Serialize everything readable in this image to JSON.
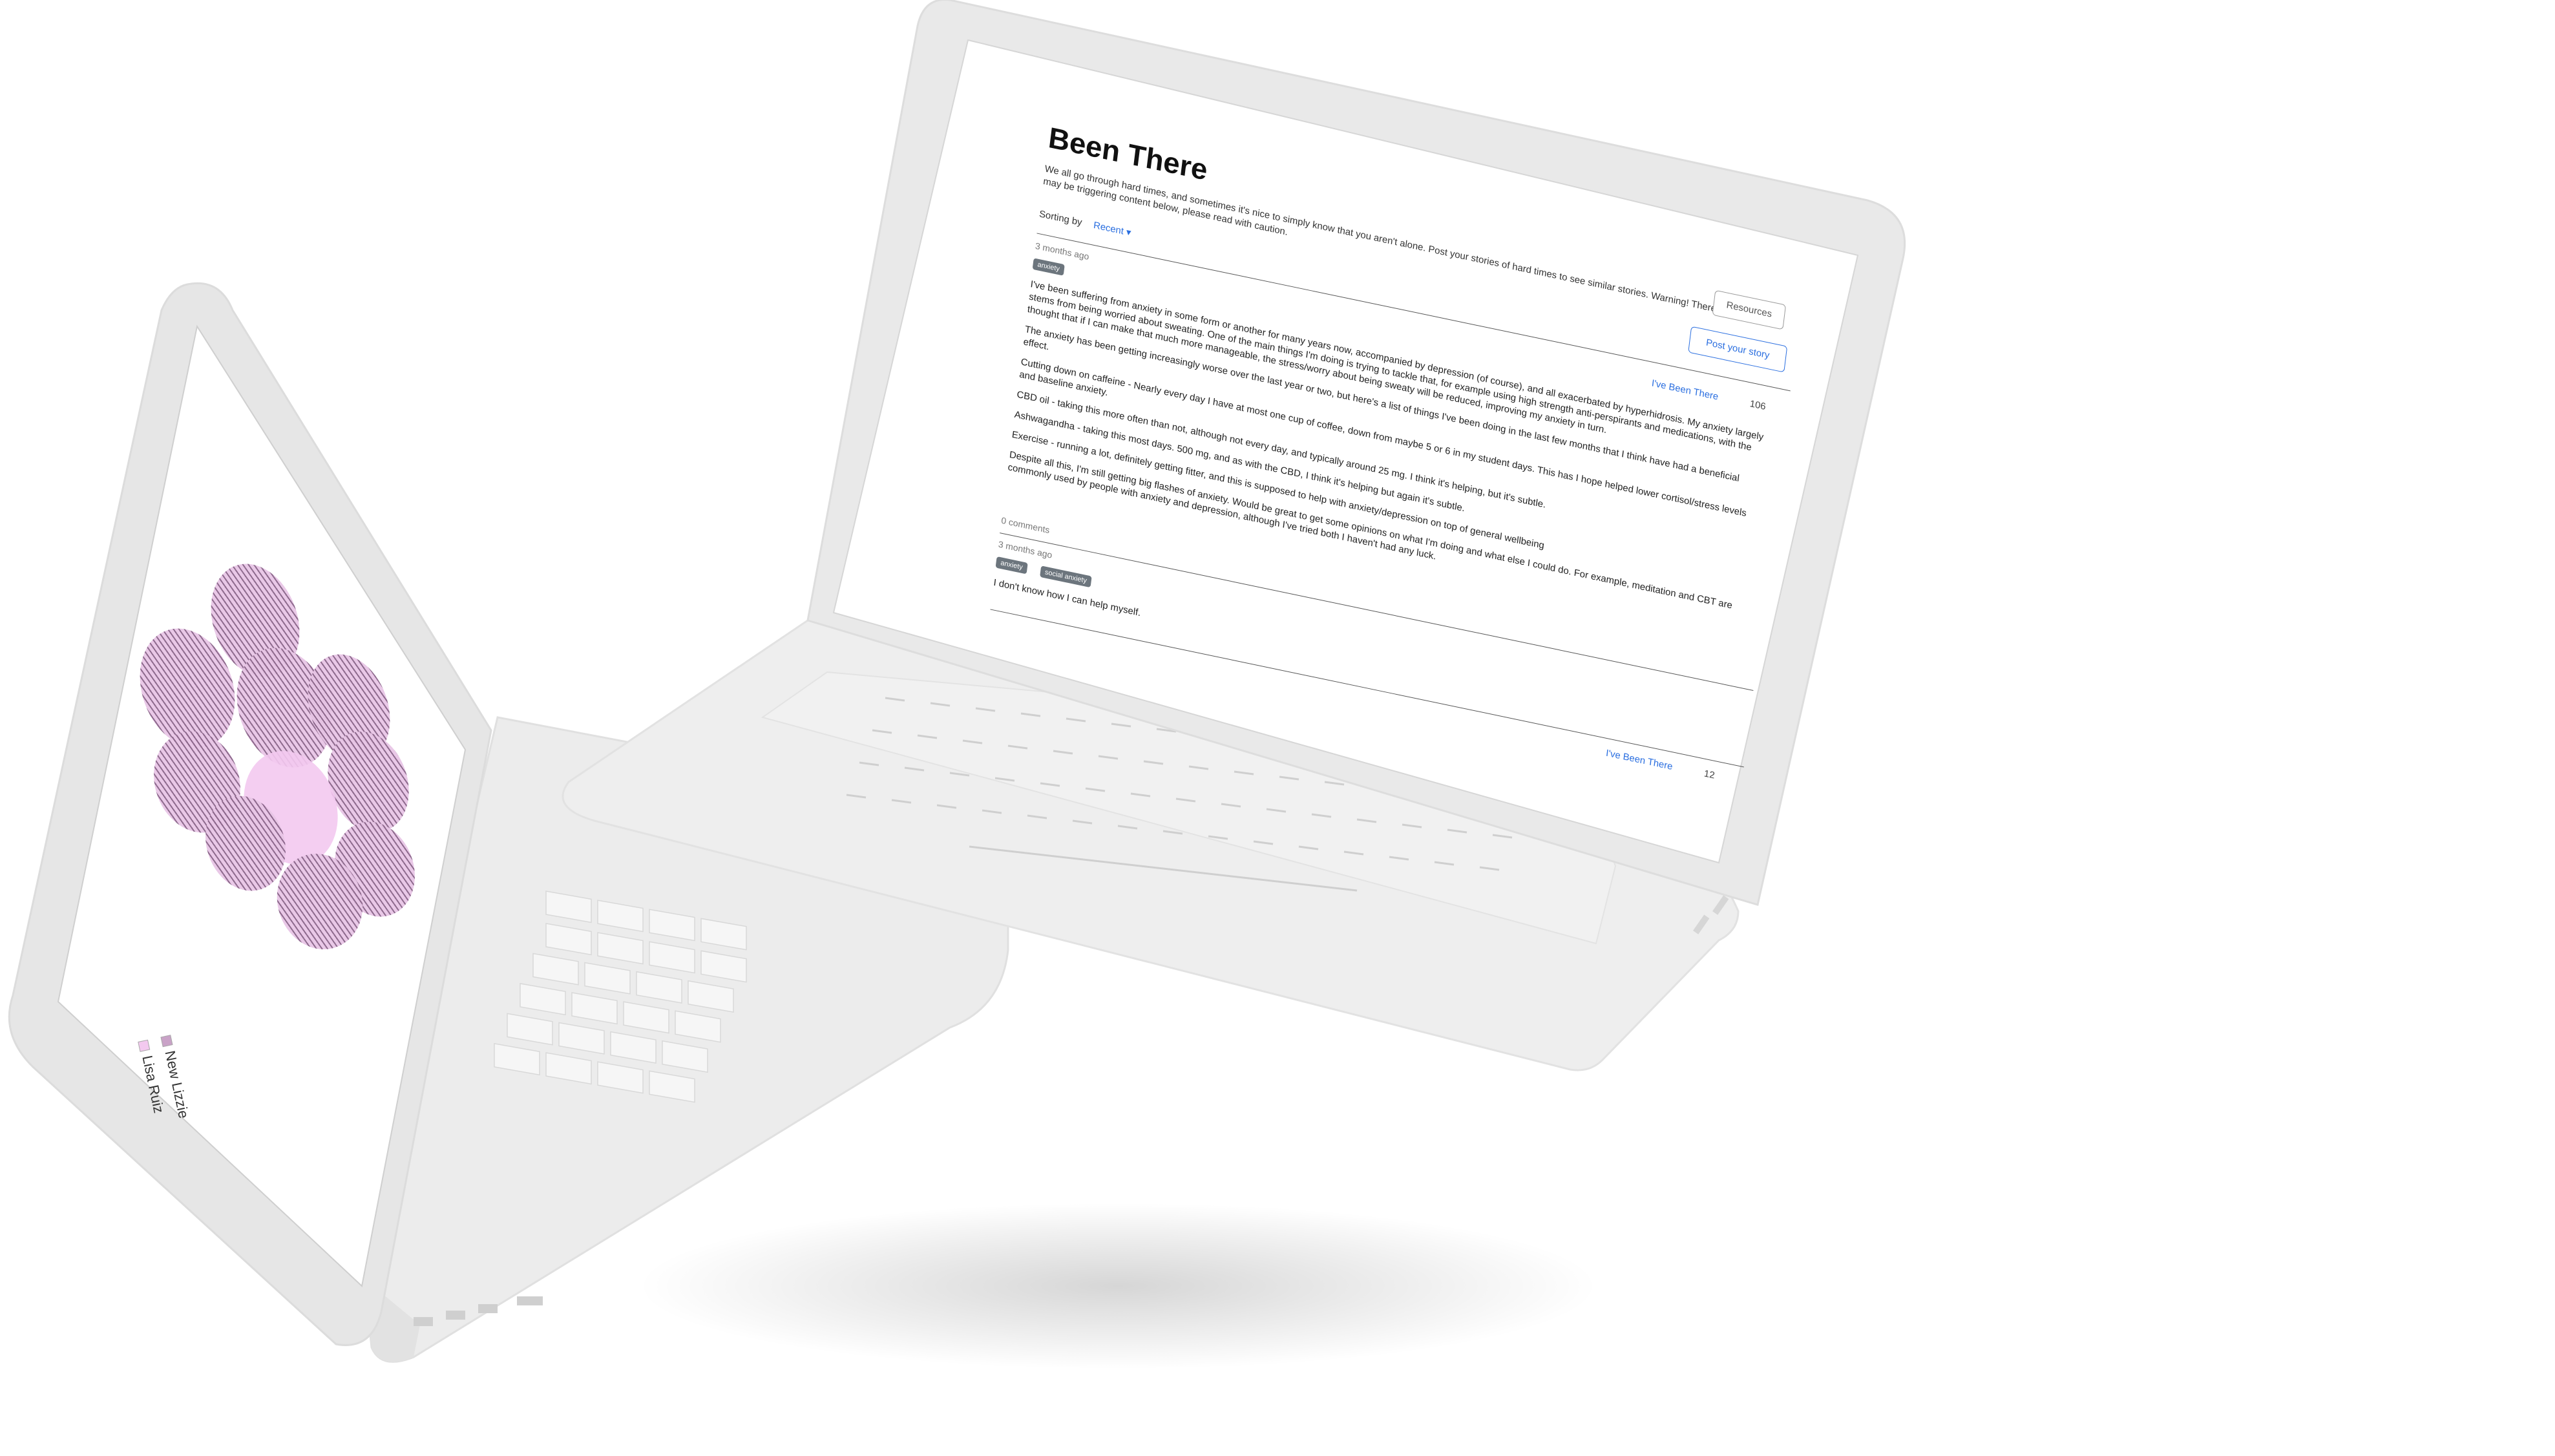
{
  "right_screen": {
    "title": "Been There",
    "intro": "We all go through hard times, and sometimes it's nice to simply know that you aren't alone. Post your stories of hard times to see similar stories. Warning! There may be triggering content below, please read with caution.",
    "sorting_label": "Sorting by",
    "sorting_value": "Recent ▾",
    "resources_button": "Resources",
    "post_story_button": "Post your story",
    "posts": [
      {
        "time": "3 months ago",
        "tags": [
          "anxiety"
        ],
        "body": [
          "I've been suffering from anxiety in some form or another for many years now, accompanied by depression (of course), and all exacerbated by hyperhidrosis. My anxiety largely stems from being worried about sweating. One of the main things I'm doing is trying to tackle that, for example using high strength anti-perspirants and medications, with the thought that if I can make that much more manageable, the stress/worry about being sweaty will be reduced, improving my anxiety in turn.",
          "The anxiety has been getting increasingly worse over the last year or two, but here's a list of things I've been doing in the last few months that I think have had a beneficial effect.",
          "Cutting down on caffeine - Nearly every day I have at most one cup of coffee, down from maybe 5 or 6 in my student days. This has I hope helped lower cortisol/stress levels and baseline anxiety.",
          "CBD oil - taking this more often than not, although not every day, and typically around 25 mg. I think it's helping, but it's subtle.",
          "Ashwagandha - taking this most days. 500 mg, and as with the CBD, I think it's helping but again it's subtle.",
          "Exercise - running a lot, definitely getting fitter, and this is supposed to help with anxiety/depression on top of general wellbeing",
          "Despite all this, I'm still getting big flashes of anxiety. Would be great to get some opinions on what I'm doing and what else I could do. For example, meditation and CBT are commonly used by people with anxiety and depression, although I've tried both I haven't had any luck."
        ],
        "been_there_label": "I've Been There",
        "been_there_count": "106",
        "comments": "0 comments"
      },
      {
        "time": "3 months ago",
        "tags": [
          "anxiety",
          "social anxiety"
        ],
        "body": [
          "I don't know how I can help myself."
        ],
        "been_there_label": "I've Been There",
        "been_there_count": "12"
      }
    ]
  },
  "left_screen": {
    "legend": [
      "New Lizzie",
      "Lisa Ruiz"
    ],
    "colors": {
      "blob": "#e8c6e6",
      "center_blob": "#f3c9ef",
      "legend_a": "#c9a2c7",
      "legend_b": "#f3c9ef"
    }
  },
  "colors": {
    "laptop_body": "#e9e9e9",
    "link_blue": "#2b6fe0",
    "tag_gray": "#6c757d"
  }
}
